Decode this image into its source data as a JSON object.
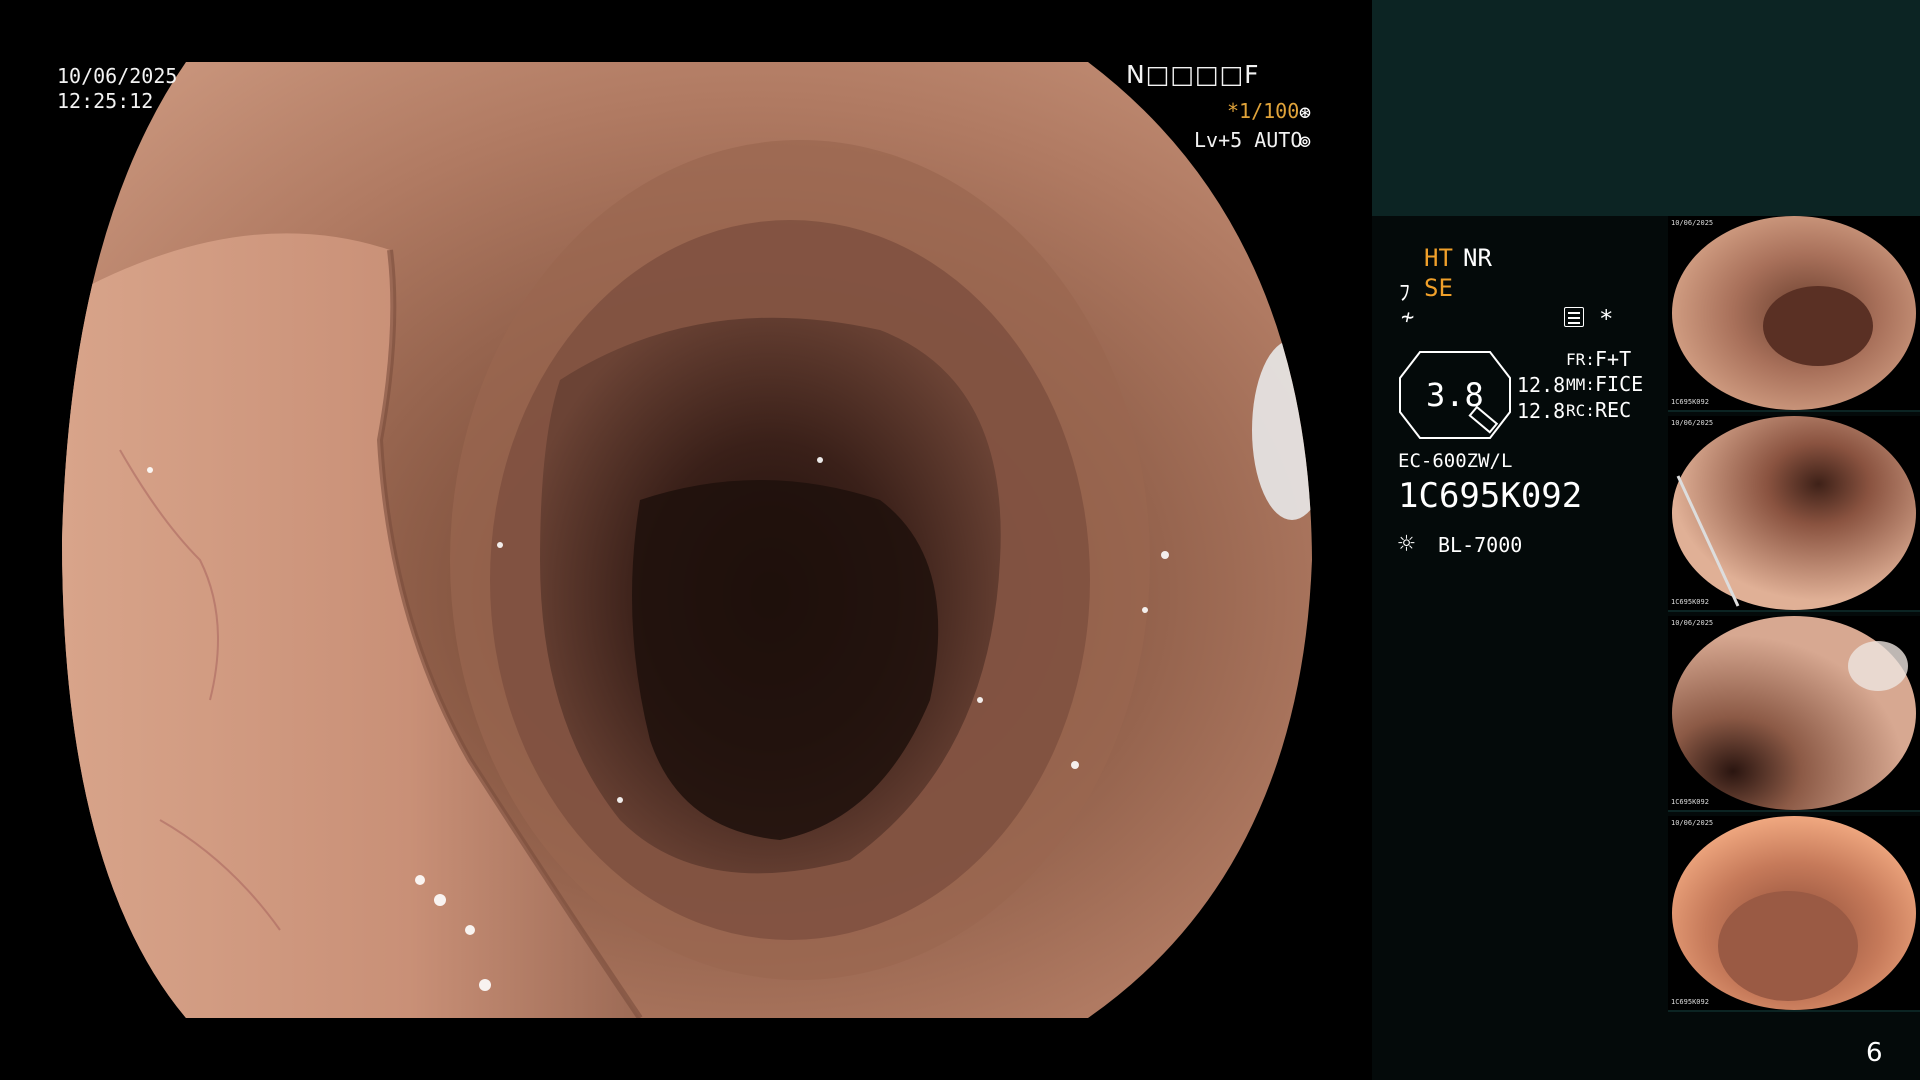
{
  "osd": {
    "date": "10/06/2025",
    "time": "12:25:12",
    "patient_boxes": "N□□□□F",
    "shutter": "*1/100",
    "shutter_icon": "aperture-icon",
    "level": "Lv+5 AUTO",
    "auto_icon": "iris-icon"
  },
  "panel": {
    "ht": "HT",
    "nr": "NR",
    "se": "SE",
    "structure_value": "3.8",
    "v1": "12.8",
    "v2": "12.8",
    "fr_label": "FR:",
    "fr_value": "F+T",
    "mm_label": "MM:",
    "mm_value": "FICE",
    "rc_label": "RC:",
    "rc_value": "REC",
    "scope_model": "EC-600ZW/L",
    "serial": "1C695K092",
    "light_source": "BL-7000",
    "page_number": "6"
  },
  "thumbnails": [
    {
      "label_top": "10/06/2025",
      "label_id": "1C695K092"
    },
    {
      "label_top": "10/06/2025",
      "label_id": "1C695K092"
    },
    {
      "label_top": "10/06/2025",
      "label_id": "1C695K092"
    },
    {
      "label_top": "10/06/2025",
      "label_id": "1C695K092"
    }
  ],
  "colors": {
    "accent": "#f0a02a",
    "panel_top": "#0c2423",
    "panel_bg": "#040a0a",
    "mucosa": "#b07a60"
  }
}
